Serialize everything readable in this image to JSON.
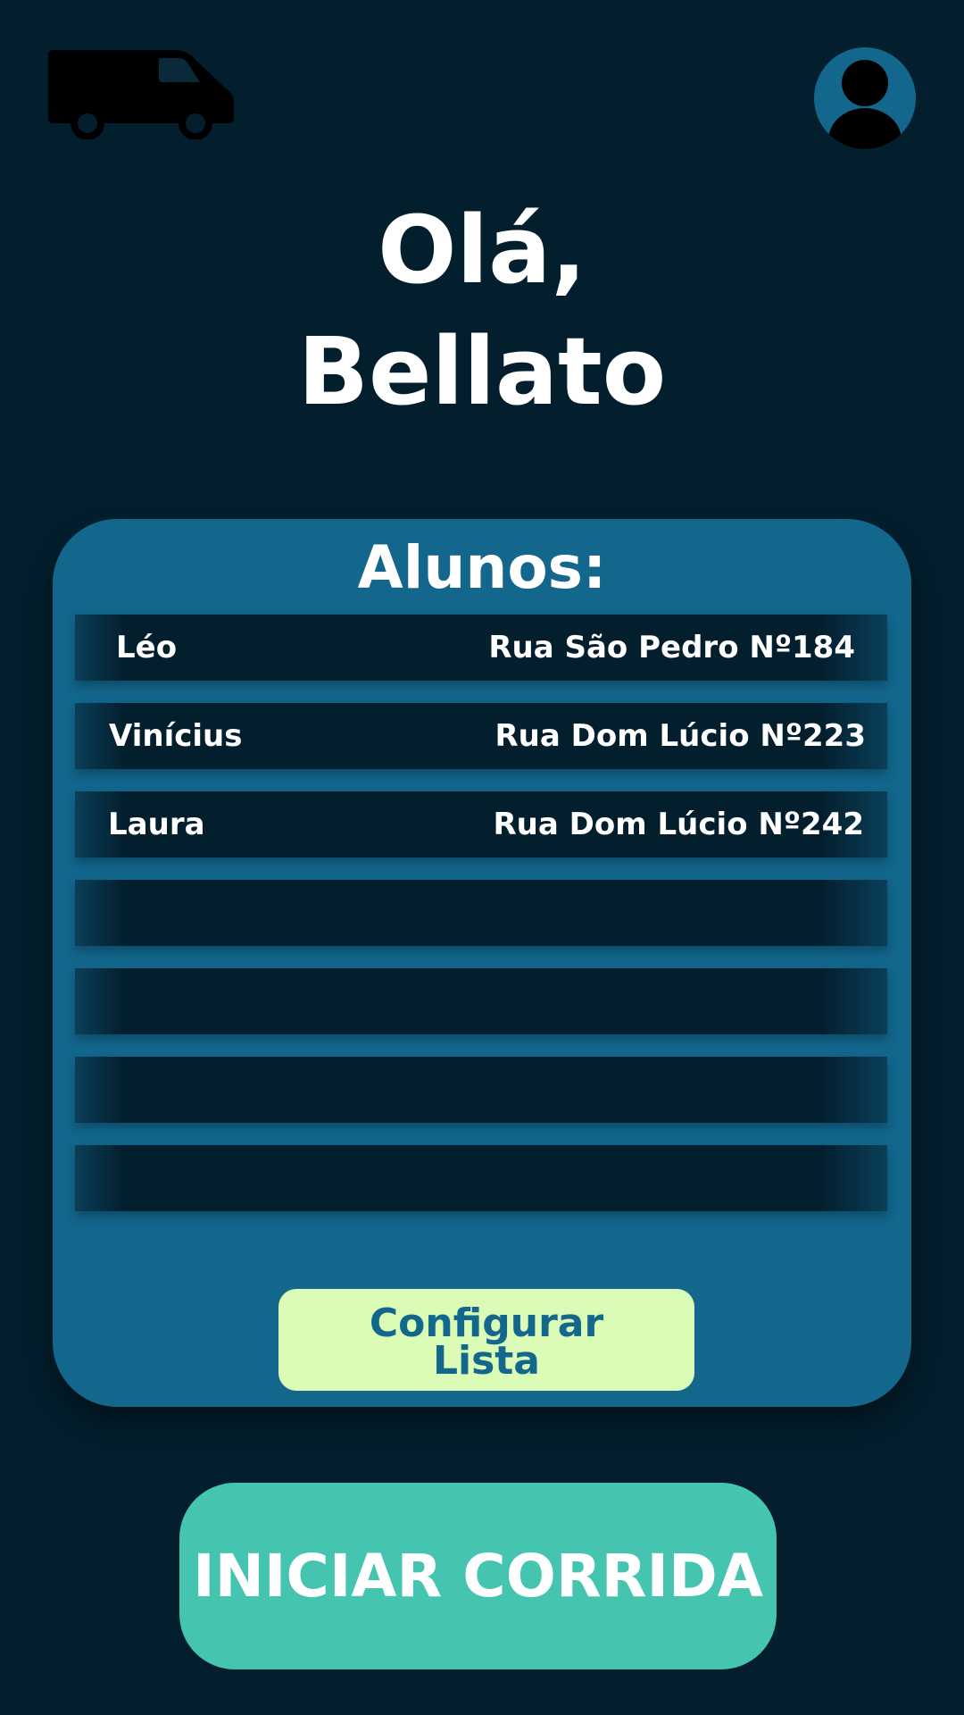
{
  "header": {
    "logo_icon": "van-icon",
    "profile_icon": "user-avatar-icon"
  },
  "greeting": {
    "line1": "Olá,",
    "line2": "Bellato"
  },
  "students_card": {
    "title": "Alunos:",
    "students": [
      {
        "name": "Léo",
        "address": "Rua São Pedro Nº184"
      },
      {
        "name": "Vinícius",
        "address": "Rua Dom Lúcio Nº223"
      },
      {
        "name": "Laura",
        "address": "Rua Dom Lúcio Nº242"
      },
      {
        "name": "",
        "address": ""
      },
      {
        "name": "",
        "address": ""
      },
      {
        "name": "",
        "address": ""
      },
      {
        "name": "",
        "address": ""
      }
    ],
    "configure_button": {
      "line1": "Configurar",
      "line2": "Lista"
    }
  },
  "start_button": {
    "label": "INICIAR CORRIDA"
  },
  "colors": {
    "background": "#031f2e",
    "card": "#13668c",
    "configure_button": "#dbfcb6",
    "start_button": "#45c5b0",
    "text_light": "#ffffff"
  }
}
